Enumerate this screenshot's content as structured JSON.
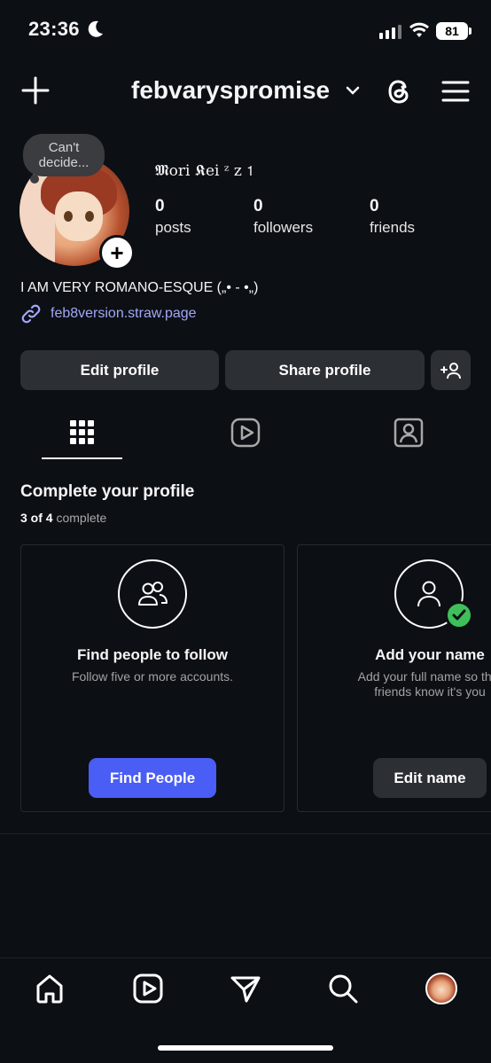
{
  "status_bar": {
    "time": "23:36",
    "battery": "81",
    "icons": [
      "moon-icon",
      "signal-icon",
      "wifi-icon",
      "battery-icon"
    ]
  },
  "header": {
    "username": "febvaryspromise",
    "icons": [
      "plus-icon",
      "chevron-down-icon",
      "threads-icon",
      "menu-icon"
    ]
  },
  "profile": {
    "note": "Can't decide...",
    "display_name": "𝕸ori 𝕶ei ᶻ z 𝟣",
    "stats": [
      {
        "value": "0",
        "label": "posts"
      },
      {
        "value": "0",
        "label": "followers"
      },
      {
        "value": "0",
        "label": "friends"
      }
    ],
    "bio": "I AM VERY ROMANO-ESQUE („• - •„)",
    "link": "feb8version.straw.page"
  },
  "buttons": {
    "edit_profile": "Edit profile",
    "share_profile": "Share profile"
  },
  "tabs": [
    "grid-icon",
    "reels-icon",
    "tagged-icon"
  ],
  "complete_profile": {
    "title": "Complete your profile",
    "progress_count": "3 of 4",
    "progress_word": "complete",
    "cards": [
      {
        "title": "Find people to follow",
        "desc": "Follow five or more accounts.",
        "button": "Find People"
      },
      {
        "title": "Add your name",
        "desc_line1": "Add your full name so that",
        "desc_line2": "friends know it's you",
        "button": "Edit name"
      }
    ]
  },
  "bottom_nav": [
    "home-icon",
    "reels-icon",
    "send-icon",
    "search-icon",
    "profile-avatar"
  ],
  "colors": {
    "background": "#0c0f14",
    "button_bg": "#2c2f34",
    "accent_blue": "#4a5df5",
    "link": "#a3a7f6",
    "check_green": "#3fbf5a"
  }
}
